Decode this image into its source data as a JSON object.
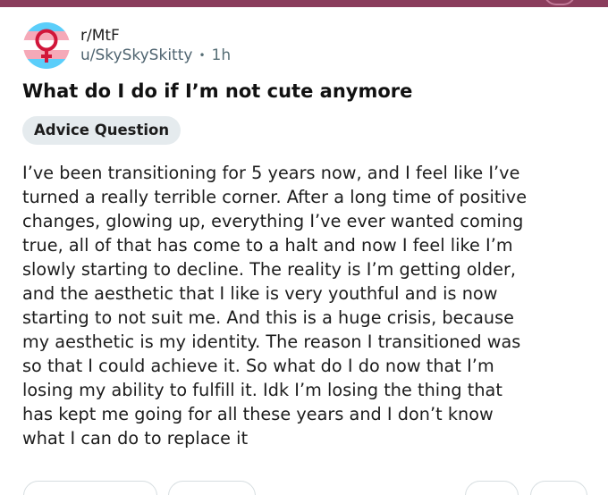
{
  "post": {
    "subreddit": "r/MtF",
    "author": "u/SkySkySkitty",
    "separator": "•",
    "time_ago": "1h",
    "title": "What do I do if I’m not cute anymore",
    "flair": "Advice Question",
    "body": "I’ve been transitioning for 5 years now, and I feel like I’ve\nturned a really terrible corner. After a long time of positive\nchanges, glowing up, everything I’ve ever wanted coming\ntrue, all of that has come to a halt and now I feel like I’m\nslowly starting to decline. The reality is I’m getting older,\nand the aesthetic that I like is very youthful and is now\nstarting to not suit me. And this is a huge crisis, because\nmy aesthetic is my identity. The reason I transitioned was\nso that I could achieve it. So what do I do now that I’m\nlosing my ability to fulfill it. Idk I’m losing the thing that\nhas kept me going for all these years and I don’t know\nwhat I can do to replace it"
  },
  "icons": {
    "avatar": "trans-flag-female-symbol-icon"
  },
  "colors": {
    "top_strip": "#8a3d5c",
    "flair_background": "#e5ebee",
    "flag_blue": "#5bcefa",
    "flag_pink": "#f5a9b8",
    "flag_white": "#ffffff",
    "symbol": "#d1163a"
  }
}
